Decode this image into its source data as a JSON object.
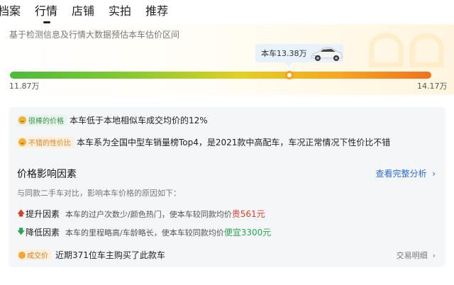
{
  "tabs": [
    {
      "label": "档案",
      "active": false
    },
    {
      "label": "行情",
      "active": true
    },
    {
      "label": "店铺",
      "active": false
    },
    {
      "label": "实拍",
      "active": false
    },
    {
      "label": "推荐",
      "active": false
    }
  ],
  "valuation": {
    "description": "基于检测信息及行情大数据预估本车估价区间",
    "car_price_label": "本车13.38万",
    "range_min": "11.87万",
    "range_max": "14.17万",
    "marker_value": 13.38,
    "range_min_value": 11.87,
    "range_max_value": 14.17,
    "gradient_colors": [
      "#4bbb3b",
      "#e3cf25",
      "#f2711d"
    ]
  },
  "highlights": [
    {
      "tag": "很棒的价格",
      "tag_color": "#3f8f52",
      "text": "本车低于本地相似车成交均价的12%"
    },
    {
      "tag": "不错的性价比",
      "tag_color": "#d5862a",
      "text": "本车系为全国中型车销量榜Top4，是2021款中高配车，车况正常情况下性价比不错"
    }
  ],
  "factors": {
    "title": "价格影响因素",
    "full_link": "查看完整分析",
    "link_icon": "chevron-right-icon",
    "intro": "与同款二手车对比，影响本车价格的原因如下：",
    "raise": {
      "icon": "arrow-up-icon",
      "label": "提升因素",
      "text": "本车的过户次数少/颜色热门，使本车较同款均价",
      "value": "贵561元",
      "color": "#e03b2e"
    },
    "lower": {
      "icon": "arrow-down-icon",
      "label": "降低因素",
      "text": "本车的里程略高/车龄略长，使本车较同款均价",
      "value": "便宜3300元",
      "color": "#2aa452"
    }
  },
  "transactions": {
    "tag": "成交价",
    "text": "近期371位车主购买了此款车",
    "link": "交易明细"
  }
}
